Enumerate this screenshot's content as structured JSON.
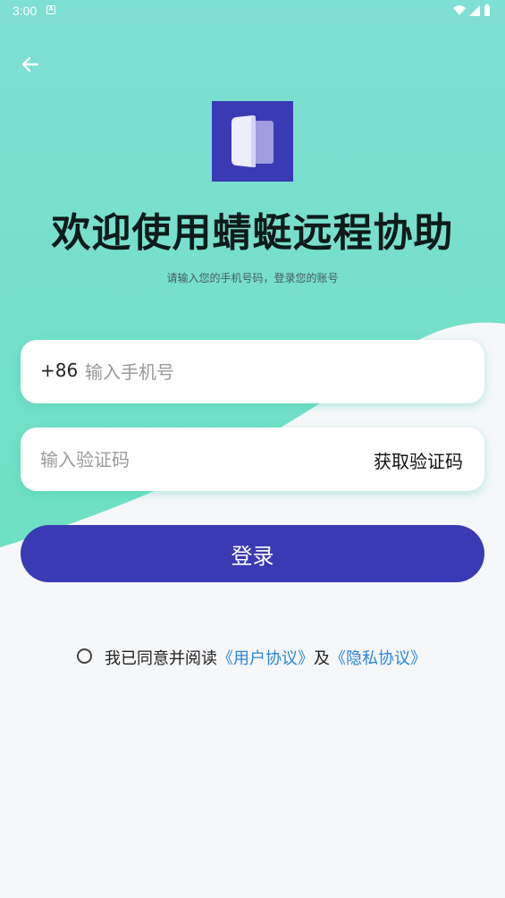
{
  "status_bar": {
    "time": "3:00",
    "notification_icon": "a-badge-icon",
    "indicators": [
      "wifi-icon",
      "signal-icon",
      "battery-icon"
    ]
  },
  "header": {
    "back_icon": "arrow-left-icon"
  },
  "brand": {
    "logo_icon": "book-icon",
    "title": "欢迎使用蜻蜓远程协助",
    "subtitle": "请输入您的手机号码，登录您的账号"
  },
  "form": {
    "country_code": "+86",
    "phone_placeholder": "输入手机号",
    "phone_value": "",
    "code_placeholder": "输入验证码",
    "code_value": "",
    "get_code_label": "获取验证码",
    "login_label": "登录"
  },
  "agreement": {
    "checked": false,
    "prefix": "我已同意并阅读",
    "user_agreement": "《用户协议》",
    "and": "及",
    "privacy_policy": "《隐私协议》"
  },
  "colors": {
    "accent": "#3a3ab5",
    "teal_top": "#7edfd3",
    "teal_bottom": "#6fe0c4",
    "link": "#2a86d8",
    "background": "#f6f7f9"
  }
}
